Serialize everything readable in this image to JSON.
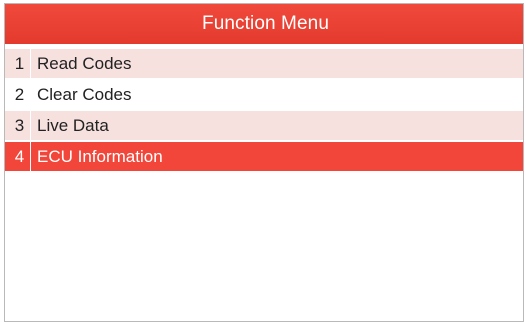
{
  "title": "Function Menu",
  "menu": {
    "items": [
      {
        "number": "1",
        "label": "Read Codes"
      },
      {
        "number": "2",
        "label": "Clear Codes"
      },
      {
        "number": "3",
        "label": "Live Data"
      },
      {
        "number": "4",
        "label": "ECU Information"
      }
    ],
    "selected_index": 3
  },
  "colors": {
    "accent": "#f2463a",
    "title_bar": "#e8403a",
    "row_shade": "#f6e1df"
  }
}
